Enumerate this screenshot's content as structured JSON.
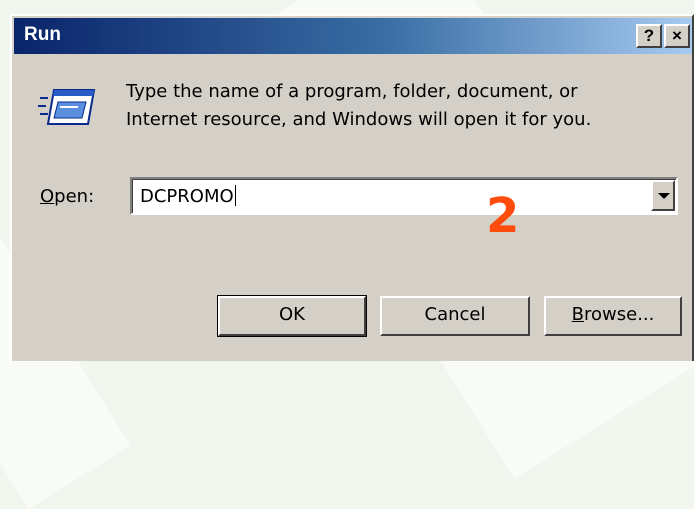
{
  "window": {
    "title": "Run",
    "help_button": "?",
    "close_button": "×"
  },
  "instructions": "Type the name of a program, folder, document, or\nInternet resource, and Windows will open it for you.",
  "open_field": {
    "label_accel": "O",
    "label_rest": "pen:",
    "value": "DCPROMO"
  },
  "annotation": {
    "step_number": "2",
    "color": "#ff4c0c"
  },
  "buttons": {
    "ok": "OK",
    "cancel": "Cancel",
    "browse_accel": "B",
    "browse_rest": "rowse..."
  },
  "colors": {
    "titlebar_start": "#0a246a",
    "titlebar_end": "#a6caf0",
    "dialog_face": "#d4d0c8"
  }
}
